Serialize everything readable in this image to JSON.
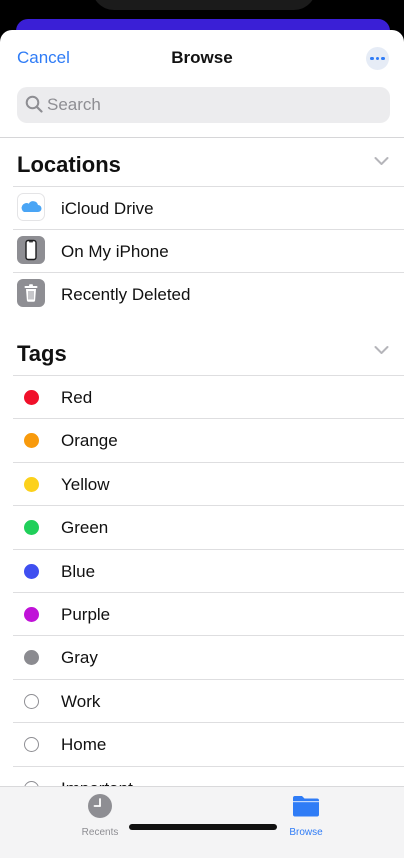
{
  "nav": {
    "cancel_label": "Cancel",
    "title": "Browse"
  },
  "search": {
    "placeholder": "Search"
  },
  "locations": {
    "header": "Locations",
    "items": [
      {
        "label": "iCloud Drive",
        "icon": "icloud-icon"
      },
      {
        "label": "On My iPhone",
        "icon": "iphone-icon"
      },
      {
        "label": "Recently Deleted",
        "icon": "trash-icon"
      }
    ]
  },
  "tags": {
    "header": "Tags",
    "items": [
      {
        "label": "Red",
        "color": "#f0102a"
      },
      {
        "label": "Orange",
        "color": "#f89a0c"
      },
      {
        "label": "Yellow",
        "color": "#fcd11c"
      },
      {
        "label": "Green",
        "color": "#20cf5a"
      },
      {
        "label": "Blue",
        "color": "#3f4ff0"
      },
      {
        "label": "Purple",
        "color": "#c012d8"
      },
      {
        "label": "Gray",
        "color": "#8b8b90"
      },
      {
        "label": "Work",
        "color": "none"
      },
      {
        "label": "Home",
        "color": "none"
      },
      {
        "label": "Important",
        "color": "none"
      }
    ]
  },
  "tabbar": {
    "recents_label": "Recents",
    "browse_label": "Browse"
  },
  "colors": {
    "accent": "#2f7cf6",
    "top_strip": "#3a1fd6"
  }
}
